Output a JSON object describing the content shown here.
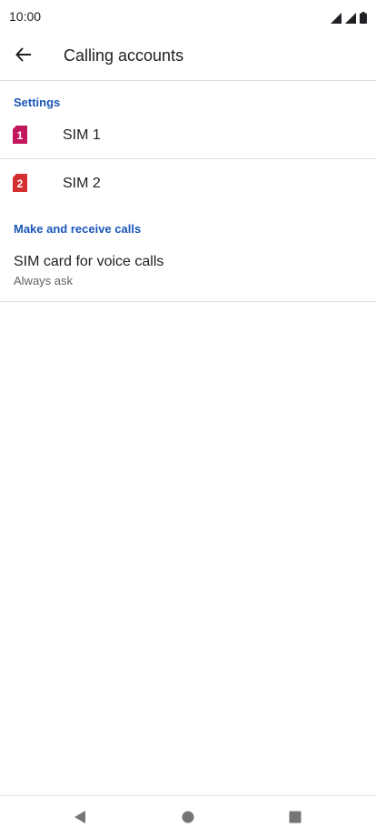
{
  "status_bar": {
    "time": "10:00",
    "icons": [
      "signal-icon",
      "signal-icon",
      "battery-icon"
    ]
  },
  "app_bar": {
    "title": "Calling accounts",
    "back_icon": "arrow-back-icon"
  },
  "sections": {
    "settings_header": "Settings",
    "calls_header": "Make and receive calls"
  },
  "sims": [
    {
      "label": "SIM 1",
      "badge": "1",
      "color": "#c2185b",
      "icon": "sim-card-icon"
    },
    {
      "label": "SIM 2",
      "badge": "2",
      "color": "#d32f2f",
      "icon": "sim-card-icon"
    }
  ],
  "voice_calls": {
    "title": "SIM card for voice calls",
    "summary": "Always ask"
  },
  "colors": {
    "accent": "#1a56b8",
    "divider": "#dadce0",
    "nav_icon": "#757575"
  },
  "nav_bar": {
    "icons": [
      "back-triangle-icon",
      "home-circle-icon",
      "recents-square-icon"
    ]
  }
}
